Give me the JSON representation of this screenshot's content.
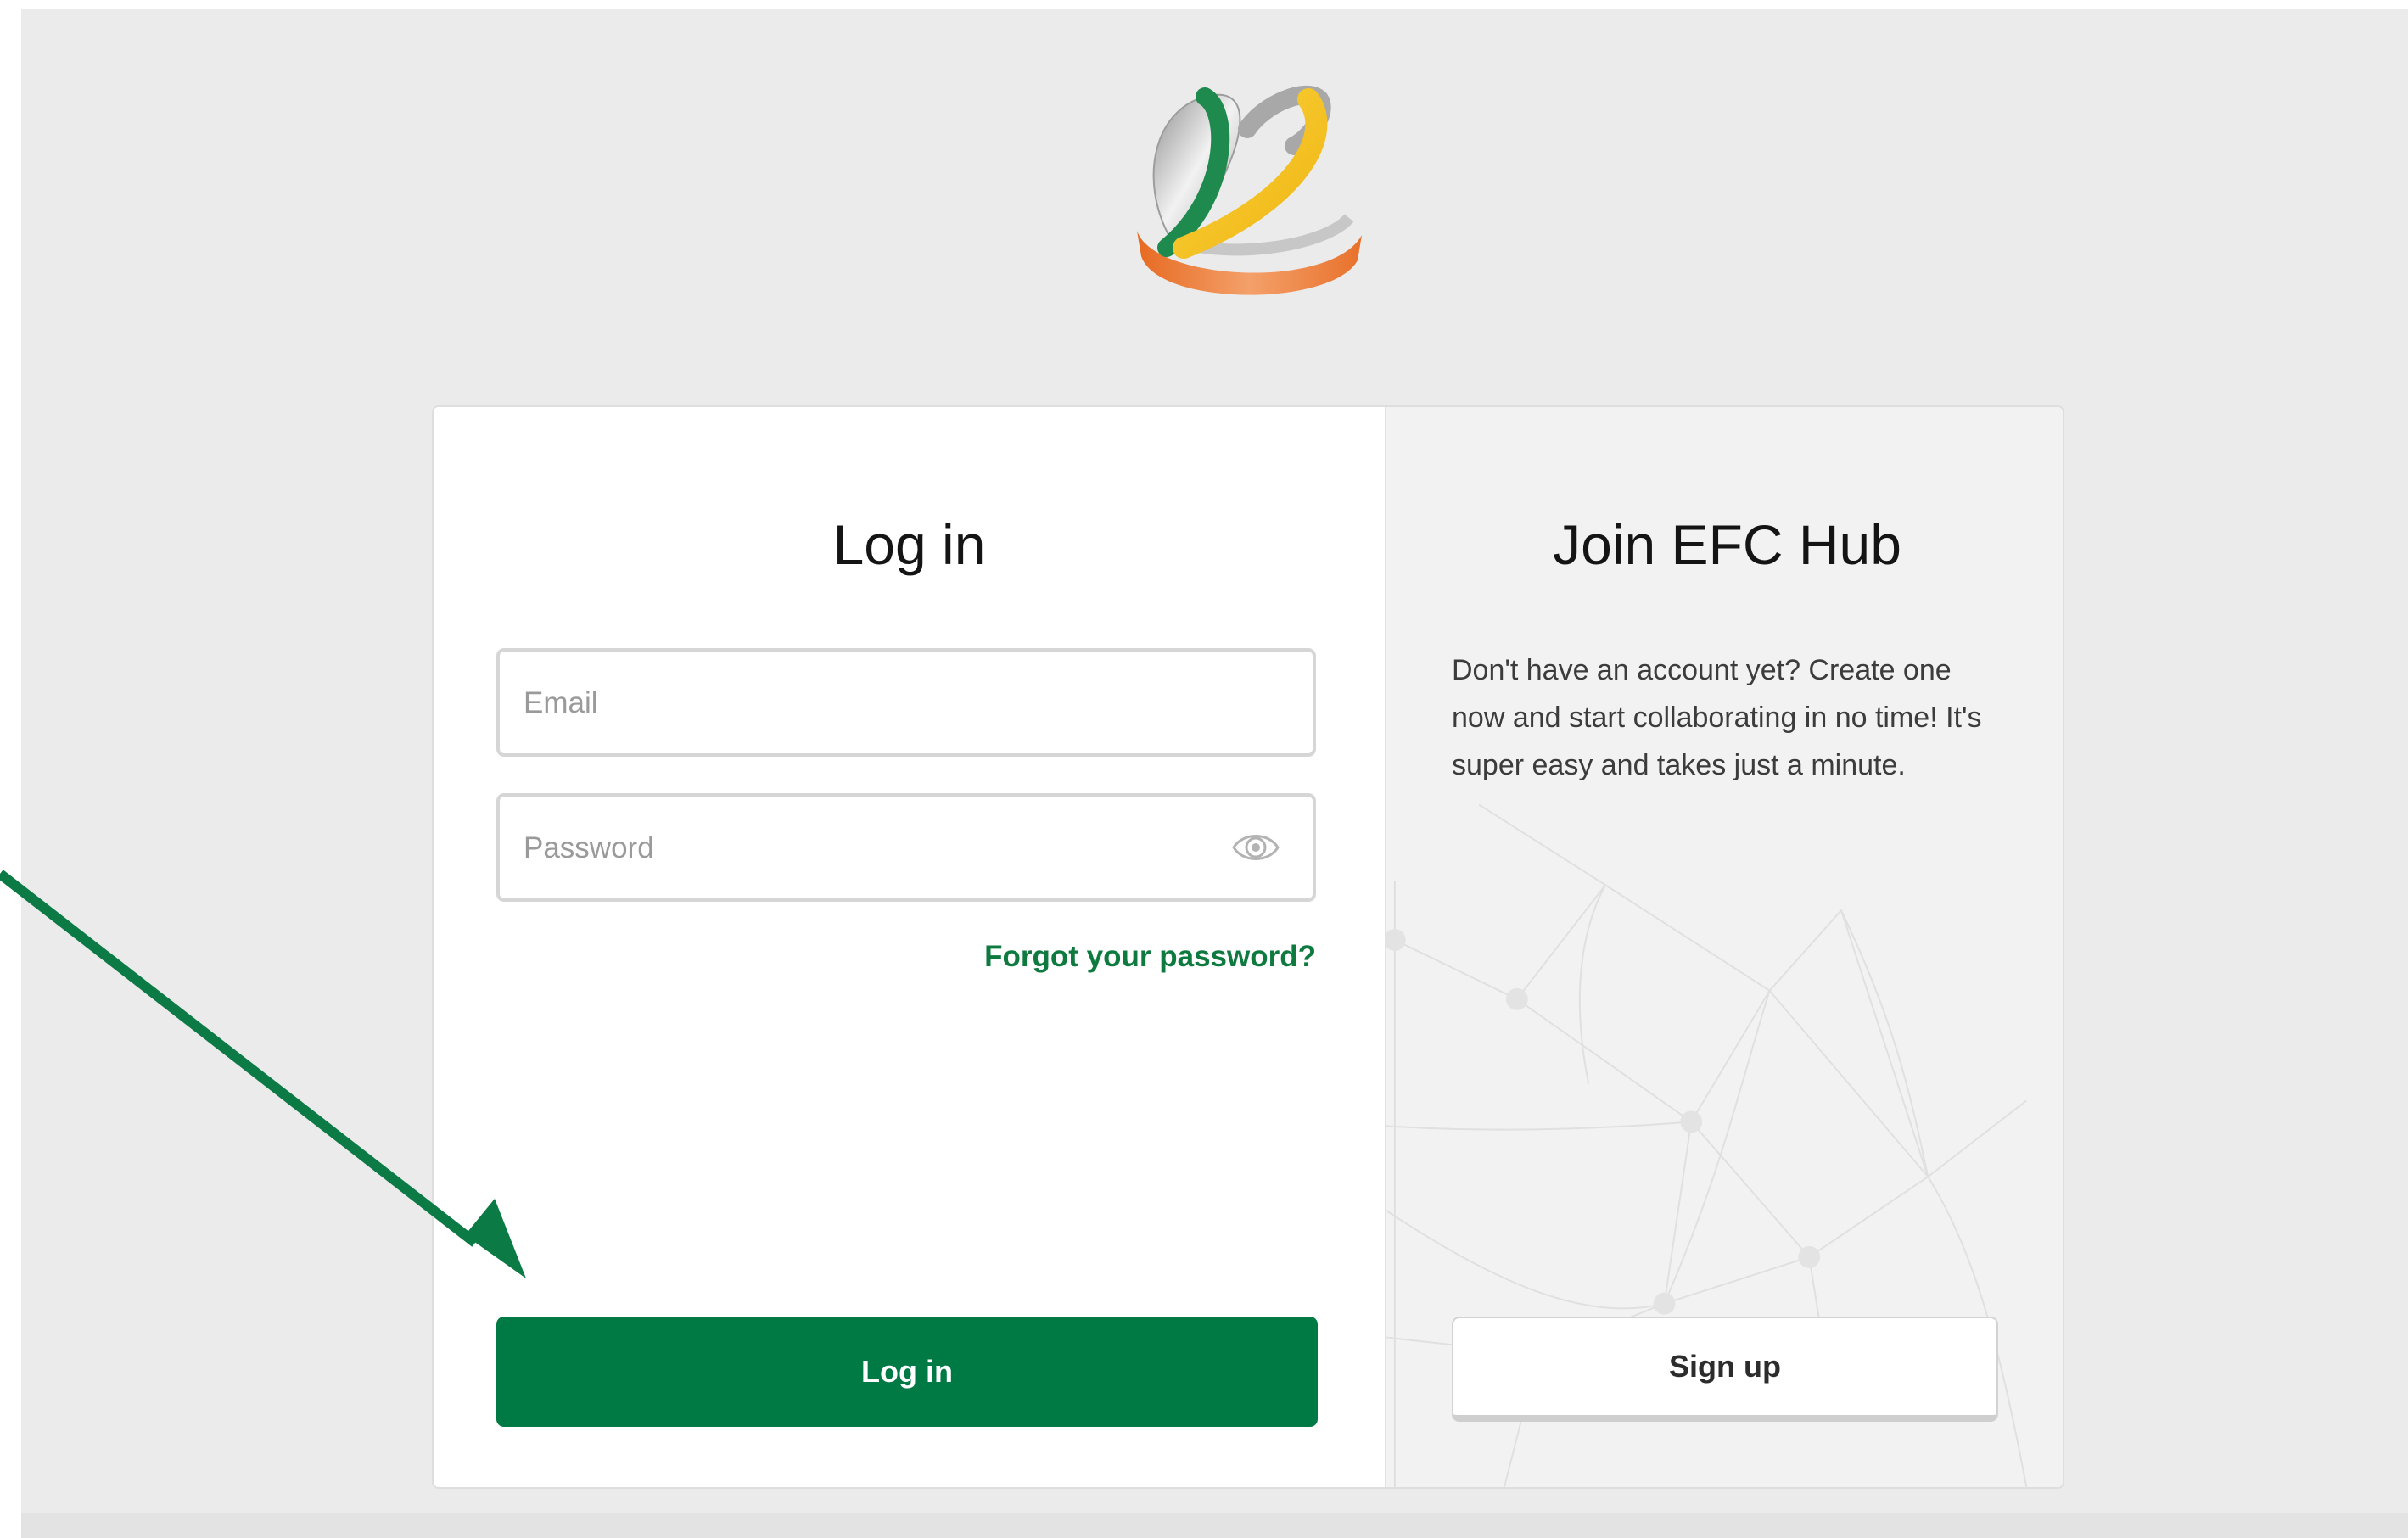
{
  "login": {
    "title": "Log in",
    "email_placeholder": "Email",
    "password_placeholder": "Password",
    "forgot_link": "Forgot your password?",
    "submit_label": "Log in"
  },
  "join": {
    "title": "Join EFC Hub",
    "description": "Don't have an account yet? Create one now and start collaborating in no time! It's super easy and takes just a minute.",
    "signup_label": "Sign up"
  },
  "colors": {
    "brand_green": "#007a45",
    "link_green": "#0f7a3f",
    "logo_orange": "#e8712b",
    "logo_yellow": "#f6c620",
    "logo_gray": "#b5b5b5",
    "annotation_arrow": "#0b7a45"
  },
  "icons": {
    "password_toggle": "eye-icon",
    "logo": "interlocking-rings-logo",
    "annotation": "arrow-pointer"
  }
}
